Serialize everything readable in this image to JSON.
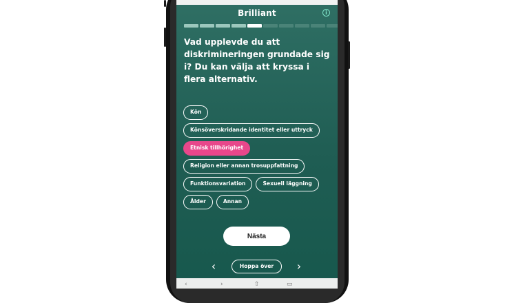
{
  "app": {
    "title": "Brilliant"
  },
  "progress": {
    "total": 10,
    "current_index": 4
  },
  "question": {
    "text": "Vad upplevde du att diskrimineringen grundade sig i? Du kan välja att kryssa i flera alternativ."
  },
  "options": [
    {
      "label": "Kön",
      "selected": false
    },
    {
      "label": "Könsöverskridande identitet eller uttryck",
      "selected": false
    },
    {
      "label": "Etnisk tillhörighet",
      "selected": true
    },
    {
      "label": "Religion eller annan trosuppfattning",
      "selected": false
    },
    {
      "label": "Funktionsvariation",
      "selected": false
    },
    {
      "label": "Sexuell läggning",
      "selected": false
    },
    {
      "label": "Ålder",
      "selected": false
    },
    {
      "label": "Annan",
      "selected": false
    }
  ],
  "buttons": {
    "next_label": "Nästa",
    "skip_label": "Hoppa över"
  },
  "colors": {
    "accent_selected": "#e8478b",
    "background": "#23645a",
    "progress_done": "#9cc7bd",
    "info_icon": "#7ee3c8"
  },
  "icons": {
    "info": "info-icon",
    "prev": "chevron-left-icon",
    "next": "chevron-right-icon"
  }
}
